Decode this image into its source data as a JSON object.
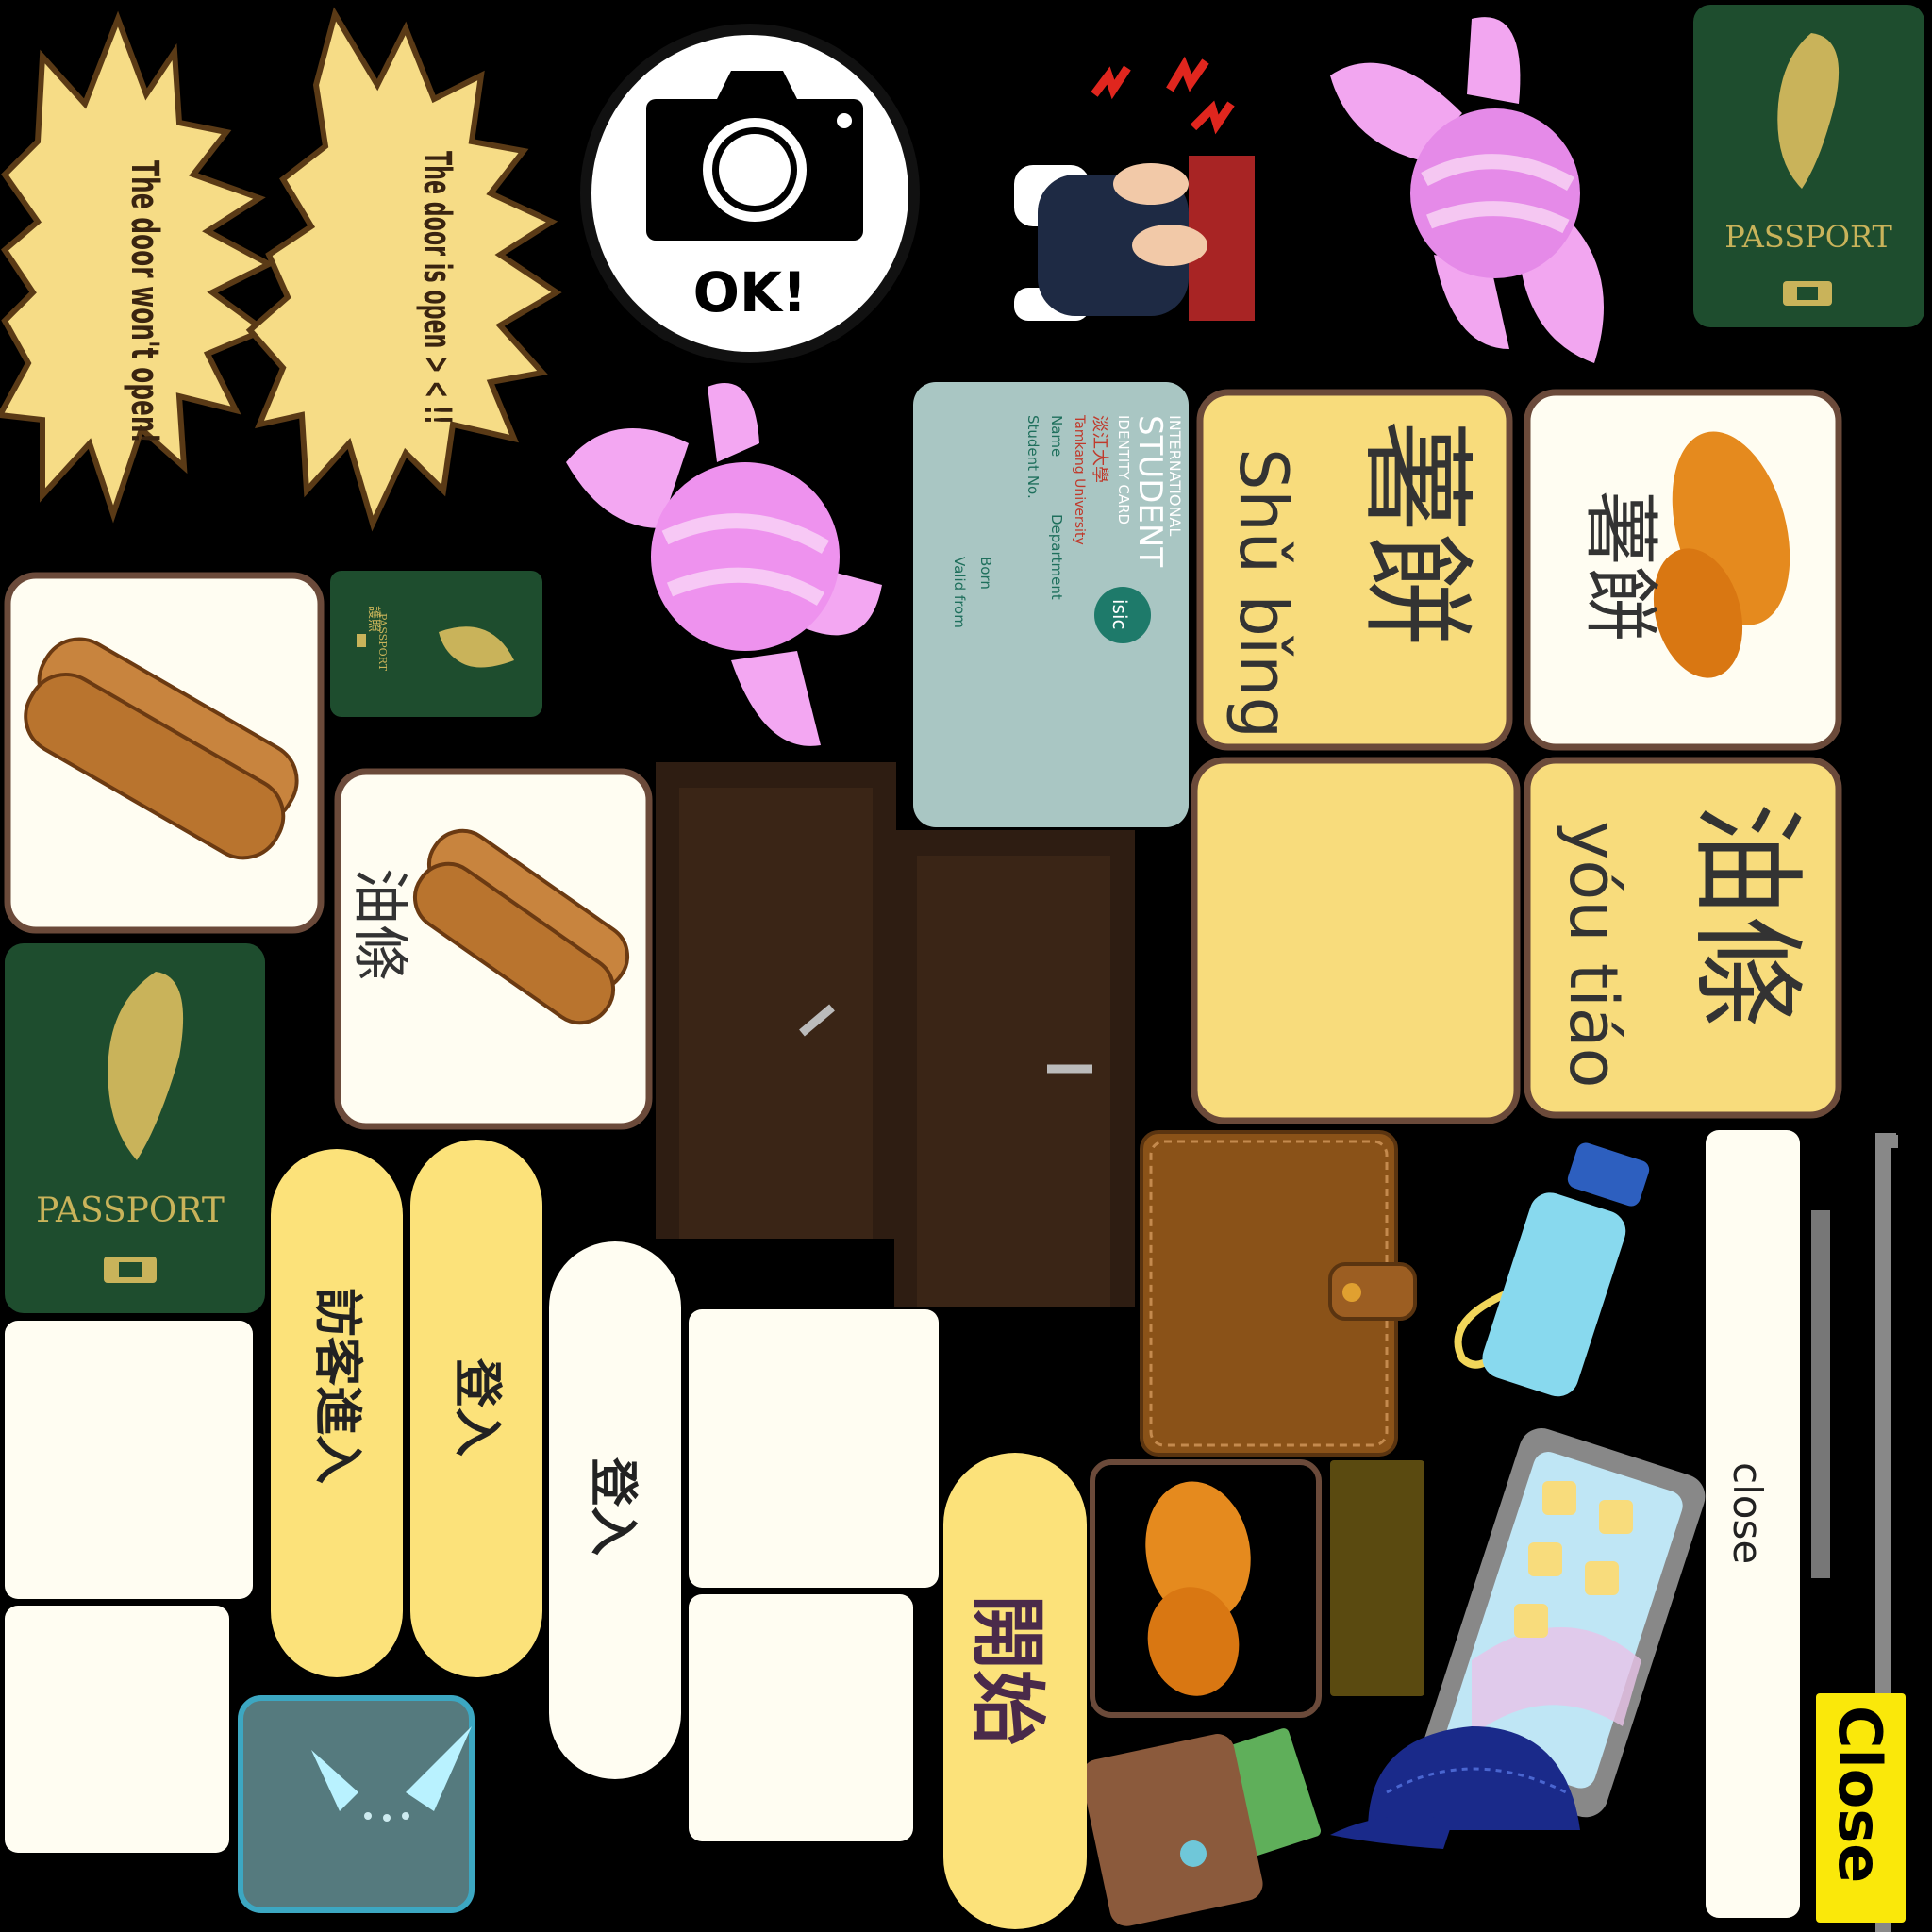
{
  "speech_bursts": {
    "door_locked": "The door won't open!",
    "door_open": "The door is open > < !!"
  },
  "camera_badge": {
    "label": "OK!"
  },
  "passport": {
    "label": "PASSPORT",
    "small_label_zh": "護照",
    "small_label_en": "PASSPORT"
  },
  "student_id_card": {
    "header_lines": [
      "INTERNATIONAL",
      "STUDENT",
      "IDENTITY CARD"
    ],
    "school_zh": "淡江大學",
    "school_en": "Tamkang University",
    "field_name": "Name",
    "field_student_no": "Student No.",
    "field_department": "Department",
    "field_born": "Born",
    "field_valid_from": "Valid from",
    "logo": "isic"
  },
  "food_cards": {
    "shubing_zh": "薯餅",
    "shubing_pinyin": "Shǔ bǐng",
    "youtiao_zh": "油條",
    "youtiao_pinyin": "yóu tiáo"
  },
  "buttons": {
    "guest_login": "訪客進入",
    "login_yellow": "登入",
    "login_white": "登入",
    "start": "開始",
    "close_white": "close",
    "close_yellow": "Close"
  },
  "colors": {
    "background": "#000000",
    "card_yellow": "#F8DC7C",
    "card_cream": "#FFFDF2",
    "card_border": "#6B4A3A",
    "passport_green": "#1E4D2E",
    "passport_gold": "#C9B35A",
    "burst_fill": "#F6DC86",
    "burst_outline": "#5A3A16",
    "button_yellow": "#FCE27A",
    "door_brown": "#2E1D12",
    "candy_pink": "#F2A6F0",
    "id_card_teal": "#A9C6C3",
    "wallet_brown": "#8A5218"
  },
  "icons": [
    "camera-icon",
    "candy-icon",
    "passport-icon",
    "hash-brown-icon",
    "youtiao-icon",
    "door-icon",
    "wallet-icon",
    "water-bottle-icon",
    "smartphone-icon",
    "cap-icon",
    "shirt-icon",
    "knees-pain-icon"
  ]
}
